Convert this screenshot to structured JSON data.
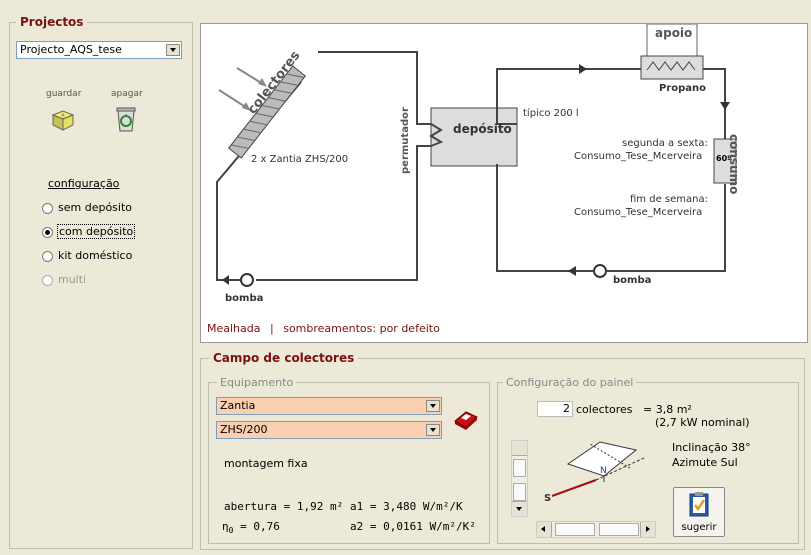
{
  "projects": {
    "legend": "Projectos",
    "selected": "Projecto_AQS_tese",
    "save_label": "guardar",
    "delete_label": "apagar"
  },
  "configuration": {
    "title": "configuração",
    "options": [
      "sem depósito",
      "com depósito",
      "kit doméstico",
      "multi"
    ],
    "selected_index": 1
  },
  "diagram": {
    "collectors_label": "colectores",
    "collectors_model": "2 x Zantia ZHS/200",
    "exchanger_label": "permutador",
    "tank_label": "depósito",
    "tank_volume": "típico 200 l",
    "backup_label": "apoio",
    "backup_fuel": "Propano",
    "consumption_label": "consumo",
    "consumption_temp": "60º",
    "weekday_label": "segunda a sexta:",
    "weekday_profile": "Consumo_Tese_Mcerveira",
    "weekend_label": "fim de semana:",
    "weekend_profile": "Consumo_Tese_Mcerveira",
    "pump_label_left": "bomba",
    "pump_label_right": "bomba",
    "location": "Mealhada",
    "separator": "|",
    "shading": "sombreamentos: por defeito"
  },
  "collector_field": {
    "legend": "Campo de colectores",
    "equipment": {
      "legend": "Equipamento",
      "manufacturer": "Zantia",
      "model": "ZHS/200",
      "mounting": "montagem fixa",
      "aperture": "abertura = 1,92 m²",
      "eta0": "= 0,76",
      "a1": "a1 = 3,480  W/m²/K",
      "a2": "a2 = 0,0161 W/m²/K²"
    },
    "panel": {
      "legend": "Configuração do painel",
      "count": "2",
      "count_label": "colectores",
      "area": "= 3,8 m²",
      "nominal": "(2,7 kW nominal)",
      "tilt": "Inclinação 38°",
      "azimuth": "Azimute Sul",
      "north_label": "N",
      "south_label": "S",
      "suggest_label": "sugerir"
    }
  },
  "colors": {
    "accent": "#7a1010",
    "field_highlight": "#fbd0b0"
  }
}
